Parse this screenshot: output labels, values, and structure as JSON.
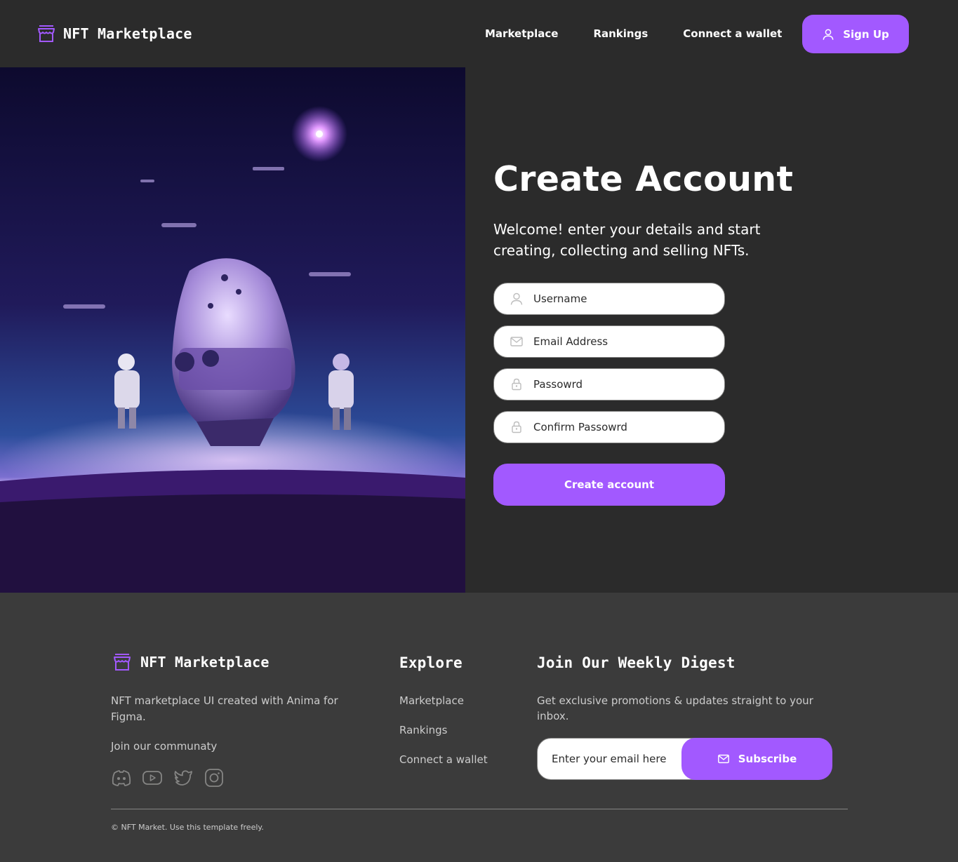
{
  "colors": {
    "accent": "#a259ff",
    "background": "#2b2b2b",
    "footer_background": "#3b3b3b",
    "muted_text": "#cccccc"
  },
  "header": {
    "logo_text": "NFT Marketplace",
    "logo_icon": "storefront-icon",
    "nav": [
      {
        "label": "Marketplace"
      },
      {
        "label": "Rankings"
      },
      {
        "label": "Connect a wallet"
      }
    ],
    "signup_label": "Sign Up",
    "signup_icon": "user-icon"
  },
  "hero": {
    "image": "astronauts-spaceship-planet-illustration"
  },
  "form": {
    "title": "Create Account",
    "subtitle": "Welcome! enter your details and start creating, collecting and selling NFTs.",
    "fields": [
      {
        "placeholder": "Username",
        "icon": "user-icon"
      },
      {
        "placeholder": "Email Address",
        "icon": "envelope-icon"
      },
      {
        "placeholder": "Passowrd",
        "icon": "lock-icon"
      },
      {
        "placeholder": "Confirm Passowrd",
        "icon": "lock-icon"
      }
    ],
    "submit_label": "Create account"
  },
  "footer": {
    "logo_text": "NFT Marketplace",
    "description": "NFT marketplace UI created with Anima for Figma.",
    "community_label": "Join our communaty",
    "socials": [
      "discord-icon",
      "youtube-icon",
      "twitter-icon",
      "instagram-icon"
    ],
    "explore_heading": "Explore",
    "explore_links": [
      {
        "label": "Marketplace"
      },
      {
        "label": "Rankings"
      },
      {
        "label": "Connect a wallet"
      }
    ],
    "digest_heading": "Join Our Weekly Digest",
    "digest_text": "Get exclusive promotions & updates straight to your inbox.",
    "email_placeholder": "Enter your email here",
    "subscribe_label": "Subscribe",
    "subscribe_icon": "envelope-icon",
    "copyright": "© NFT Market. Use this template freely."
  }
}
